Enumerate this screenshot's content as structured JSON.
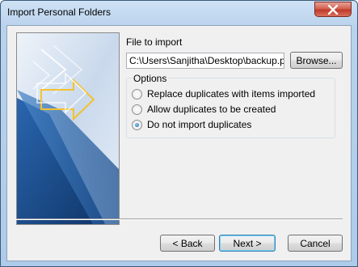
{
  "window": {
    "title": "Import Personal Folders",
    "colors": {
      "frame": "#b9d2ec",
      "close": "#c0392b",
      "art_blue": "#1e4f8f",
      "arrow_yellow": "#f2c230"
    }
  },
  "form": {
    "file_label": "File to import",
    "file_path": "C:\\Users\\Sanjitha\\Desktop\\backup.pst",
    "browse_label": "Browse...",
    "options_label": "Options",
    "options": [
      {
        "label": "Replace duplicates with items imported",
        "checked": false
      },
      {
        "label": "Allow duplicates to be created",
        "checked": false
      },
      {
        "label": "Do not import duplicates",
        "checked": true
      }
    ]
  },
  "footer": {
    "back_label": "< Back",
    "next_label": "Next >",
    "cancel_label": "Cancel"
  }
}
